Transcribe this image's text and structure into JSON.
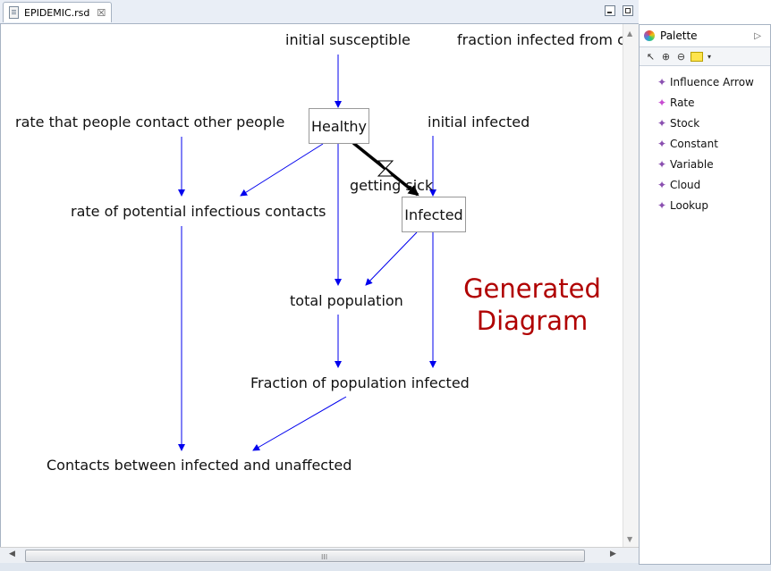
{
  "editor": {
    "tab_label": "EPIDEMIC.rsd",
    "close_glyph": "☒"
  },
  "diagram": {
    "nodes": {
      "initial_susceptible": "initial susceptible",
      "fraction_infected_from_cont": "fraction infected from cont",
      "rate_contact": "rate that people contact other people",
      "healthy": "Healthy",
      "initial_infected": "initial infected",
      "getting_sick": "getting sick",
      "infected": "Infected",
      "rate_potential": "rate of potential infectious contacts",
      "total_population": "total population",
      "fraction_population_infected": "Fraction of population infected",
      "contacts_between": "Contacts between infected and unaffected"
    },
    "watermark_line1": "Generated",
    "watermark_line2": "Diagram",
    "arrow_color": "#0000ee",
    "flow_color": "#000000",
    "watermark_color": "#b00000"
  },
  "palette": {
    "title": "Palette",
    "items": [
      {
        "label": "Influence Arrow"
      },
      {
        "label": "Rate"
      },
      {
        "label": "Stock"
      },
      {
        "label": "Constant"
      },
      {
        "label": "Variable"
      },
      {
        "label": "Cloud"
      },
      {
        "label": "Lookup"
      }
    ]
  },
  "scrollbar": {
    "grip": "III"
  }
}
